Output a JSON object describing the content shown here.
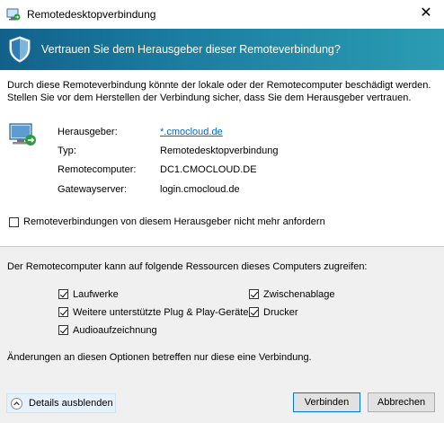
{
  "window": {
    "title": "Remotedesktopverbindung",
    "close_glyph": "✕"
  },
  "banner": {
    "text": "Vertrauen Sie dem Herausgeber dieser Remoteverbindung?",
    "icon": "shield-icon"
  },
  "intro": {
    "text": "Durch diese Remoteverbindung könnte der lokale oder der Remotecomputer beschädigt werden. Stellen Sie vor dem Herstellen der Verbindung sicher, dass Sie dem Herausgeber vertrauen."
  },
  "details": {
    "icon": "remote-computer-icon",
    "publisher_label": "Herausgeber:",
    "publisher_value": "*.cmocloud.de",
    "type_label": "Typ:",
    "type_value": "Remotedesktopverbindung",
    "remote_computer_label": "Remotecomputer:",
    "remote_computer_value": "DC1.CMOCLOUD.DE",
    "gateway_label": "Gatewayserver:",
    "gateway_value": "login.cmocloud.de"
  },
  "dont_ask": {
    "label": "Remoteverbindungen von diesem Herausgeber nicht mehr anfordern",
    "checked": false
  },
  "resources": {
    "heading": "Der Remotecomputer kann auf folgende Ressourcen dieses Computers zugreifen:",
    "items": [
      {
        "label": "Laufwerke",
        "checked": true
      },
      {
        "label": "Zwischenablage",
        "checked": true
      },
      {
        "label": "Weitere unterstützte Plug & Play-Geräte",
        "checked": true
      },
      {
        "label": "Drucker",
        "checked": true
      },
      {
        "label": "Audioaufzeichnung",
        "checked": true
      }
    ],
    "note": "Änderungen an diesen Optionen betreffen nur diese eine Verbindung."
  },
  "buttons": {
    "details_label": "Details ausblenden",
    "connect_label": "Verbinden",
    "cancel_label": "Abbrechen"
  },
  "colors": {
    "banner_start": "#12618a",
    "banner_end": "#2b9cb3",
    "link": "#0066cc",
    "default_button_border": "#0078d7"
  }
}
